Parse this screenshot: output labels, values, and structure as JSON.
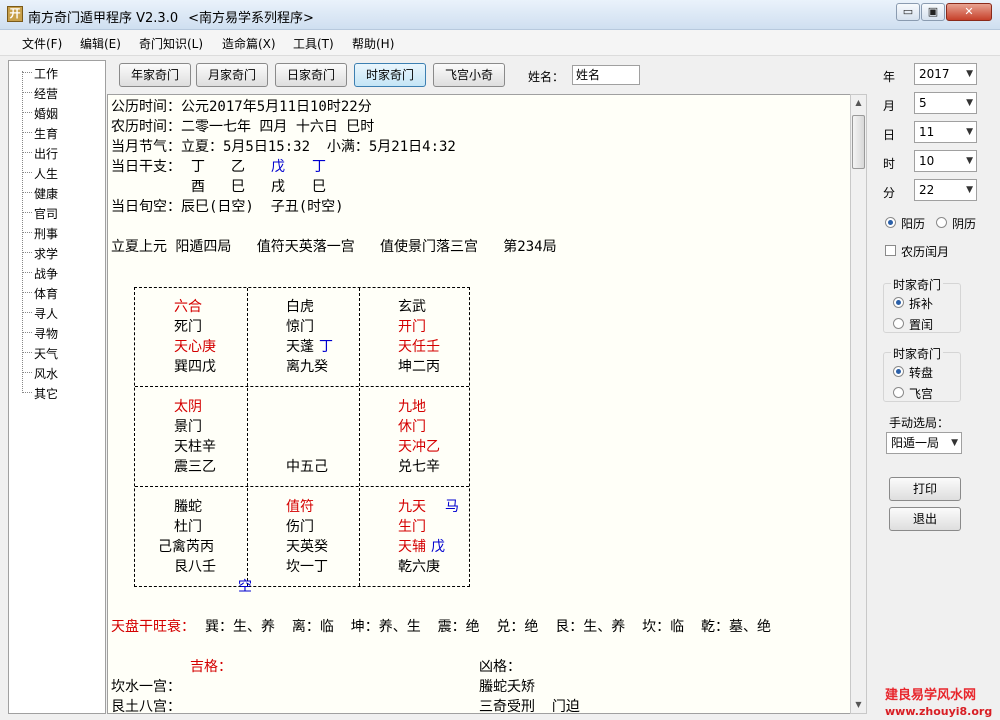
{
  "window": {
    "app_icon": "开",
    "title": "南方奇门遁甲程序 V2.3.0",
    "subtitle": "<南方易学系列程序>",
    "minimize": "▭",
    "maximize": "▣",
    "close": "✕"
  },
  "menu": [
    "文件(F)",
    "编辑(E)",
    "奇门知识(L)",
    "造命篇(X)",
    "工具(T)",
    "帮助(H)"
  ],
  "sidebar": {
    "items": [
      "工作",
      "经营",
      "婚姻",
      "生育",
      "出行",
      "人生",
      "健康",
      "官司",
      "刑事",
      "求学",
      "战争",
      "体育",
      "寻人",
      "寻物",
      "天气",
      "风水",
      "其它"
    ]
  },
  "toolbar": {
    "buttons": [
      "年家奇门",
      "月家奇门",
      "日家奇门",
      "时家奇门",
      "飞宫小奇"
    ],
    "active_index": 3,
    "name_label": "姓名：",
    "name_value": "姓名"
  },
  "content": {
    "lines": {
      "gongli": "公历时间：公元2017年5月11日10时22分",
      "nongli": "农历时间：二零一七年 四月 十六日 巳时",
      "jieqi": "当月节气：立夏：5月5日15:32  小满：5月21日4:32",
      "ganzhi_label": "当日干支：",
      "gan_1": "丁",
      "gan_2": "乙",
      "gan_3": "戊",
      "gan_4": "丁",
      "zhi_1": "酉",
      "zhi_2": "巳",
      "zhi_3": "戌",
      "zhi_4": "巳",
      "xunkong": "当日旬空：辰巳(日空)  子丑(时空)",
      "ju": "立夏上元 阳遁四局   值符天英落一宫   值使景门落三宫   第234局"
    },
    "palaces": {
      "xun": {
        "shen": "六合",
        "men": "死门",
        "xing": "天心庚",
        "gong": "巽四戊"
      },
      "li": {
        "shen": "白虎",
        "men": "惊门",
        "xing": "天蓬",
        "xing_extra": "丁",
        "gong": "离九癸"
      },
      "kun": {
        "shen": "玄武",
        "men": "开门",
        "xing": "天任壬",
        "gong": "坤二丙"
      },
      "zhen": {
        "shen": "太阴",
        "men": "景门",
        "xing": "天柱辛",
        "gong": "震三乙"
      },
      "zhong": {
        "gong": "中五己"
      },
      "dui": {
        "shen": "九地",
        "men": "休门",
        "xing": "天冲乙",
        "gong": "兑七辛"
      },
      "gen": {
        "shen": "螣蛇",
        "men": "杜门",
        "xing": "己禽芮丙",
        "gong": "艮八壬"
      },
      "kan": {
        "shen": "值符",
        "men": "伤门",
        "xing": "天英癸",
        "gong": "坎一丁"
      },
      "qian": {
        "shen": "九天",
        "ma": "马",
        "men": "生门",
        "xing": "天辅",
        "xing_extra": "戊",
        "gong": "乾六庚"
      }
    },
    "kong_mark": "空",
    "wangshuai_label": "天盘干旺衰：",
    "wangshuai": "巽：生、养  离：临  坤：养、生  震：绝  兑：绝  艮：生、养  坎：临  乾：墓、绝",
    "ji_label": "吉格：",
    "xiong_label": "凶格：",
    "kan_line": "坎水一宫：",
    "gen_line": "艮土八宫：",
    "xiong_1": "螣蛇夭矫",
    "xiong_2": "三奇受刑  门迫"
  },
  "right_panel": {
    "year_label": "年",
    "year": "2017",
    "month_label": "月",
    "month": "5",
    "day_label": "日",
    "day": "11",
    "hour_label": "时",
    "hour": "10",
    "minute_label": "分",
    "minute": "22",
    "yangli": "阳历",
    "yinli": "阴历",
    "runyue": "农历闰月",
    "group1_title": "时家奇门",
    "chaibu": "拆补",
    "zhirun": "置闰",
    "group2_title": "时家奇门",
    "zhuanpan": "转盘",
    "feigong": "飞宫",
    "manual_label": "手动选局：",
    "manual_value": "阳遁一局",
    "print": "打印",
    "exit": "退出"
  },
  "watermark": {
    "line1": "建良易学风水网",
    "line2": "www.zhouyi8.org"
  }
}
